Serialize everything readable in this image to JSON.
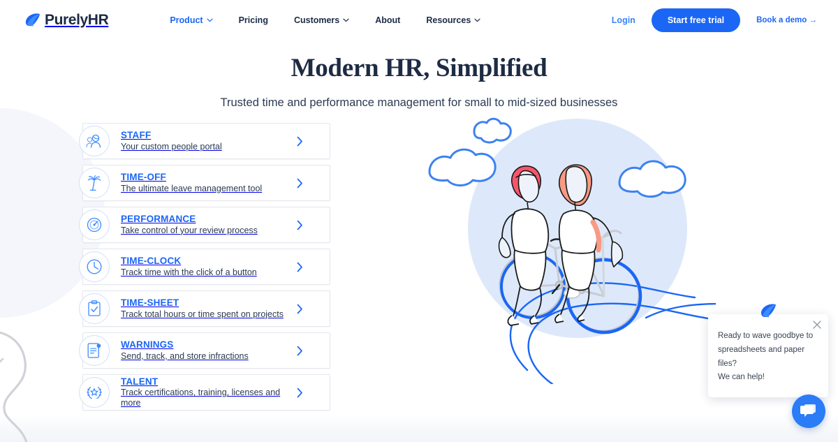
{
  "brand": {
    "name": "PurelyHR",
    "logo_icon": "leaf-drop-logo",
    "primary_color": "#1b66f5",
    "navy_color": "#1d2b44"
  },
  "nav": {
    "links": [
      {
        "label": "Product",
        "has_caret": true,
        "active": true
      },
      {
        "label": "Pricing",
        "has_caret": false,
        "active": false
      },
      {
        "label": "Customers",
        "has_caret": true,
        "active": false
      },
      {
        "label": "About",
        "has_caret": false,
        "active": false
      },
      {
        "label": "Resources",
        "has_caret": true,
        "active": false
      }
    ],
    "login_label": "Login",
    "trial_button_label": "Start free trial",
    "demo_link_label": "Book a demo →"
  },
  "hero": {
    "title": "Modern HR, Simplified",
    "subtitle": "Trusted time and performance management for small to mid-sized businesses"
  },
  "features": [
    {
      "title": "STAFF",
      "desc": "Your custom people portal",
      "icon": "people-group-icon"
    },
    {
      "title": "TIME-OFF",
      "desc": "The ultimate leave management tool",
      "icon": "palm-tree-icon"
    },
    {
      "title": "PERFORMANCE",
      "desc": "Take control of your review process",
      "icon": "speed-gauge-icon"
    },
    {
      "title": "TIME-CLOCK",
      "desc": "Track time with the click of a button",
      "icon": "clock-icon"
    },
    {
      "title": "TIME-SHEET",
      "desc": "Track total hours or time spent on projects",
      "icon": "clipboard-check-icon"
    },
    {
      "title": "WARNINGS",
      "desc": "Send, track, and store infractions",
      "icon": "document-alert-icon"
    },
    {
      "title": "TALENT",
      "desc": "Track certifications, training, licenses and more",
      "icon": "laurel-star-icon"
    }
  ],
  "illustration": {
    "alt": "Two people riding a tandem bicycle with clouds",
    "circle_color": "#dbe8fa",
    "accent_blue": "#1b66f5",
    "hair_red": "#f8556d",
    "hair_orange": "#f99a84"
  },
  "chat": {
    "avatar_icon": "leaf-drop-logo",
    "close_icon": "close-icon",
    "message": "Ready to wave goodbye to spreadsheets and paper files? We can help!",
    "message_lines": [
      "Ready to wave goodbye to",
      "spreadsheets and paper files?",
      "We can help!"
    ],
    "fab_icon": "chat-bubbles-icon",
    "fab_color": "#2a7cf7"
  }
}
